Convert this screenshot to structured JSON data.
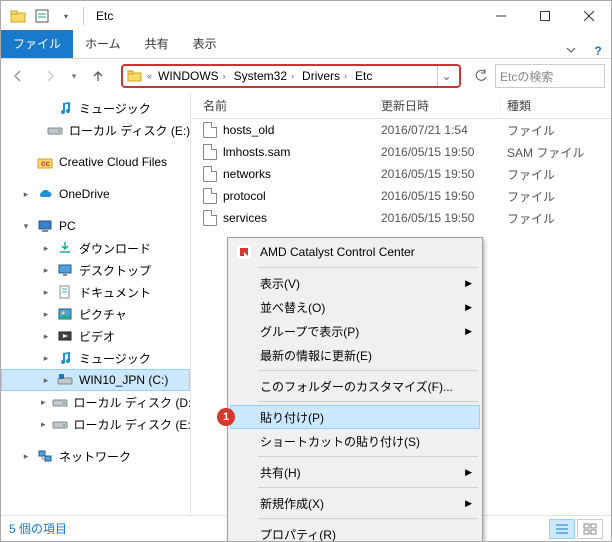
{
  "titlebar": {
    "title": "Etc"
  },
  "ribbon": {
    "file": "ファイル",
    "tabs": [
      "ホーム",
      "共有",
      "表示"
    ]
  },
  "path": {
    "segments": [
      "WINDOWS",
      "System32",
      "Drivers",
      "Etc"
    ]
  },
  "search": {
    "placeholder": "Etcの検索"
  },
  "tree": {
    "items": [
      {
        "depth": 1,
        "icon": "music",
        "label": "ミュージック"
      },
      {
        "depth": 1,
        "icon": "drive",
        "label": "ローカル ディスク (E:)"
      },
      {
        "spacer": true
      },
      {
        "depth": 0,
        "tw": "",
        "icon": "cc",
        "label": "Creative Cloud Files"
      },
      {
        "spacer": true
      },
      {
        "depth": 0,
        "tw": ">",
        "icon": "onedrive",
        "label": "OneDrive"
      },
      {
        "spacer": true
      },
      {
        "depth": 0,
        "tw": "v",
        "icon": "pc",
        "label": "PC"
      },
      {
        "depth": 1,
        "tw": ">",
        "icon": "download",
        "label": "ダウンロード"
      },
      {
        "depth": 1,
        "tw": ">",
        "icon": "desktop",
        "label": "デスクトップ"
      },
      {
        "depth": 1,
        "tw": ">",
        "icon": "doc",
        "label": "ドキュメント"
      },
      {
        "depth": 1,
        "tw": ">",
        "icon": "picture",
        "label": "ピクチャ"
      },
      {
        "depth": 1,
        "tw": ">",
        "icon": "video",
        "label": "ビデオ"
      },
      {
        "depth": 1,
        "tw": ">",
        "icon": "music",
        "label": "ミュージック"
      },
      {
        "depth": 1,
        "tw": ">",
        "icon": "os",
        "label": "WIN10_JPN (C:)",
        "selected": true
      },
      {
        "depth": 1,
        "tw": ">",
        "icon": "drive",
        "label": "ローカル ディスク (D:)"
      },
      {
        "depth": 1,
        "tw": ">",
        "icon": "drive",
        "label": "ローカル ディスク (E:)"
      },
      {
        "spacer": true
      },
      {
        "depth": 0,
        "tw": ">",
        "icon": "network",
        "label": "ネットワーク"
      }
    ]
  },
  "columns": {
    "name": "名前",
    "date": "更新日時",
    "type": "種類"
  },
  "rows": [
    {
      "name": "hosts_old",
      "date": "2016/07/21 1:54",
      "type": "ファイル"
    },
    {
      "name": "lmhosts.sam",
      "date": "2016/05/15 19:50",
      "type": "SAM ファイル"
    },
    {
      "name": "networks",
      "date": "2016/05/15 19:50",
      "type": "ファイル"
    },
    {
      "name": "protocol",
      "date": "2016/05/15 19:50",
      "type": "ファイル"
    },
    {
      "name": "services",
      "date": "2016/05/15 19:50",
      "type": "ファイル"
    }
  ],
  "context": {
    "badge": "1",
    "items": [
      {
        "icon": "amd",
        "label": "AMD Catalyst Control Center"
      },
      {
        "sep": true
      },
      {
        "label": "表示(V)",
        "submenu": true
      },
      {
        "label": "並べ替え(O)",
        "submenu": true
      },
      {
        "label": "グループで表示(P)",
        "submenu": true
      },
      {
        "label": "最新の情報に更新(E)"
      },
      {
        "sep": true
      },
      {
        "label": "このフォルダーのカスタマイズ(F)..."
      },
      {
        "sep": true
      },
      {
        "label": "貼り付け(P)",
        "hover": true,
        "badge": true
      },
      {
        "label": "ショートカットの貼り付け(S)"
      },
      {
        "sep": true
      },
      {
        "label": "共有(H)",
        "submenu": true
      },
      {
        "sep": true
      },
      {
        "label": "新規作成(X)",
        "submenu": true
      },
      {
        "sep": true
      },
      {
        "label": "プロパティ(R)"
      }
    ]
  },
  "status": {
    "text": "5 個の項目"
  }
}
